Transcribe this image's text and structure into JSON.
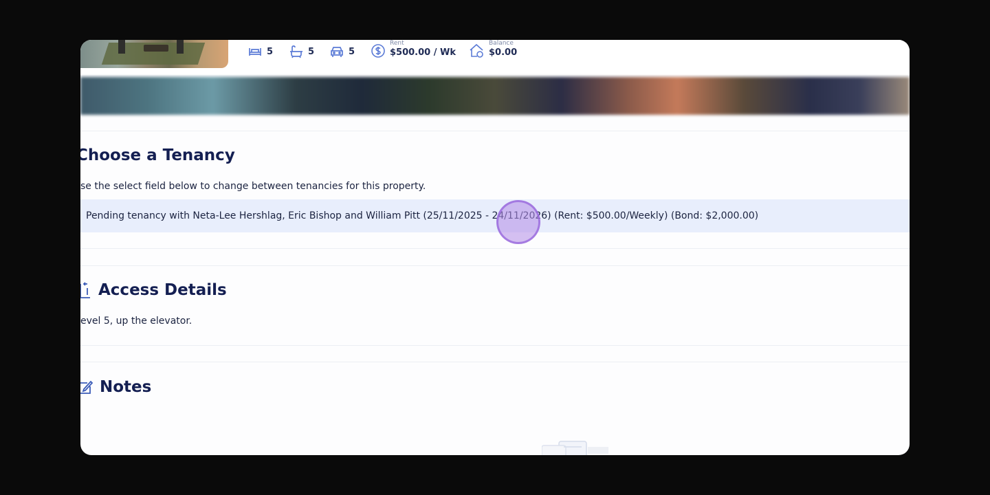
{
  "property": {
    "bedrooms": "5",
    "bathrooms": "5",
    "parking": "5",
    "rent_label": "Rent",
    "rent_value": "$500.00 / Wk",
    "balance_label": "Balance",
    "balance_value": "$0.00"
  },
  "tenancy": {
    "title": "Choose a Tenancy",
    "description": "se the select field below to change between tenancies for this property.",
    "selected_option": "Pending tenancy with Neta-Lee Hershlag, Eric Bishop and William Pitt (25/11/2025 - 24/11/2026) (Rent: $500.00/Weekly) (Bond: $2,000.00)"
  },
  "access": {
    "title": "Access Details",
    "text": "evel 5, up the elevator."
  },
  "notes": {
    "title": "Notes"
  },
  "icons": [
    "bed-icon",
    "bath-icon",
    "car-icon",
    "dollar-icon",
    "house-balance-icon",
    "access-icon",
    "pencil-icon"
  ],
  "colors": {
    "heading": "#141f52",
    "accent": "#5b7bd6",
    "selected_row": "#e8eefc",
    "cursor": "#b38de6"
  }
}
